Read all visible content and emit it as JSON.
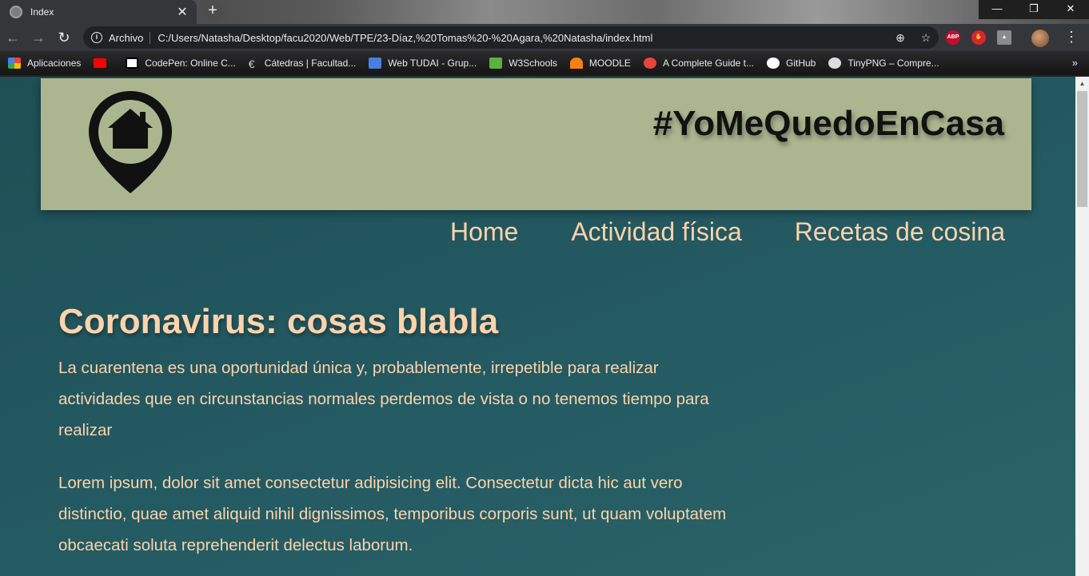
{
  "browser": {
    "tab": {
      "title": "Index",
      "close": "✕"
    },
    "new_tab": "+",
    "window": {
      "minimize": "—",
      "maximize": "❐",
      "close": "✕"
    },
    "nav": {
      "back": "←",
      "forward": "→",
      "reload": "↻"
    },
    "omnibox": {
      "info": "i",
      "scheme": "Archivo",
      "url": "C:/Users/Natasha/Desktop/facu2020/Web/TPE/23-Díaz,%20Tomas%20-%20Agara,%20Natasha/index.html",
      "zoom": "⊕",
      "star": "☆"
    },
    "extensions": {
      "abp": "ABP",
      "hand": "✋",
      "drive": "▲"
    },
    "menu": "⋮",
    "bookmarks": [
      {
        "label": "Aplicaciones",
        "icon": "apps-grid-icon",
        "color": "#e8453c"
      },
      {
        "label": "",
        "icon": "youtube-icon",
        "color": "#ff0000"
      },
      {
        "label": "CodePen: Online C...",
        "icon": "codepen-icon",
        "color": "#ffffff"
      },
      {
        "label": "Cátedras | Facultad...",
        "icon": "catedras-icon",
        "color": "#cfcfcf"
      },
      {
        "label": "Web TUDAI - Grup...",
        "icon": "groups-icon",
        "color": "#4a7fe0"
      },
      {
        "label": "W3Schools",
        "icon": "w3schools-icon",
        "color": "#5fae3f"
      },
      {
        "label": "MOODLE",
        "icon": "moodle-icon",
        "color": "#f98012"
      },
      {
        "label": "A Complete Guide t...",
        "icon": "css-tricks-icon",
        "color": "#e8453c"
      },
      {
        "label": "GitHub",
        "icon": "github-icon",
        "color": "#ffffff"
      },
      {
        "label": "TinyPNG – Compre...",
        "icon": "tinypng-icon",
        "color": "#dddddd"
      }
    ],
    "bookmarks_more": "»"
  },
  "page": {
    "site_title": "#YoMeQuedoEnCasa",
    "nav": [
      "Home",
      "Actividad física",
      "Recetas de cosina"
    ],
    "heading": "Coronavirus: cosas blabla",
    "paragraphs": [
      "La cuarentena es una oportunidad única y, probablemente, irrepetible para realizar actividades que en circunstancias normales perdemos de vista o no tenemos tiempo para realizar",
      "Lorem ipsum, dolor sit amet consectetur adipisicing elit. Consectetur dicta hic aut vero distinctio, quae amet aliquid nihil dignissimos, temporibus corporis sunt, ut quam voluptatem obcaecati soluta reprehenderit delectus laborum."
    ]
  },
  "colors": {
    "header_bg": "#abb690",
    "page_bg": "#235861",
    "accent_text": "#fcd3ac"
  }
}
